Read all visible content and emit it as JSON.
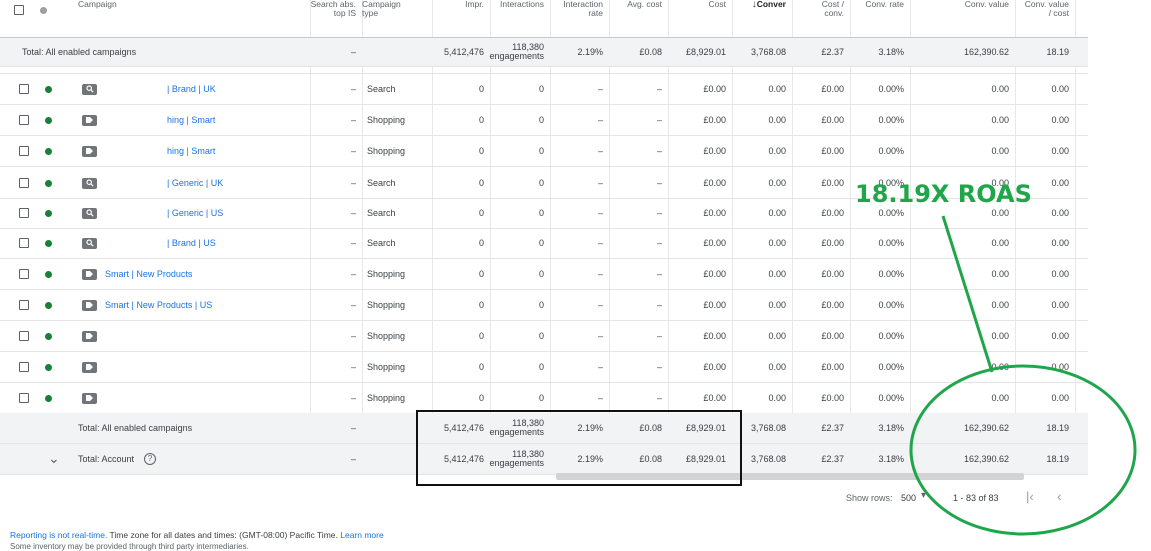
{
  "header": {
    "campaign": "Campaign",
    "search_abs": "Search abs.\ntop IS",
    "campaign_type": "Campaign\ntype",
    "impr": "Impr.",
    "interactions": "Interactions",
    "interaction_rate": "Interaction\nrate",
    "avg_cost": "Avg. cost",
    "cost": "Cost",
    "conversions": "Conver",
    "cost_conv": "Cost /\nconv.",
    "conv_rate": "Conv. rate",
    "conv_value": "Conv. value",
    "conv_value_cost": "Conv. value\n/ cost"
  },
  "top_total": {
    "label": "Total: All enabled campaigns",
    "search_abs": "–",
    "impr": "5,412,476",
    "interactions_1": "118,380",
    "interactions_2": "engagements",
    "interaction_rate": "2.19%",
    "avg_cost": "£0.08",
    "cost": "£8,929.01",
    "conversions": "3,768.08",
    "cost_conv": "£2.37",
    "conv_rate": "3.18%",
    "conv_value": "162,390.62",
    "conv_value_cost": "18.19"
  },
  "rows": [
    {
      "name": "| Brand | UK",
      "icon": "search",
      "search_abs": "–",
      "type": "Search",
      "impr": "0",
      "interactions": "0",
      "interaction_rate": "–",
      "avg_cost": "–",
      "cost": "£0.00",
      "conversions": "0.00",
      "cost_conv": "£0.00",
      "conv_rate": "0.00%",
      "conv_value": "0.00",
      "conv_value_cost": "0.00"
    },
    {
      "name": "hing | Smart",
      "icon": "tag",
      "search_abs": "–",
      "type": "Shopping",
      "impr": "0",
      "interactions": "0",
      "interaction_rate": "–",
      "avg_cost": "–",
      "cost": "£0.00",
      "conversions": "0.00",
      "cost_conv": "£0.00",
      "conv_rate": "0.00%",
      "conv_value": "0.00",
      "conv_value_cost": "0.00"
    },
    {
      "name": "hing | Smart",
      "icon": "tag",
      "search_abs": "–",
      "type": "Shopping",
      "impr": "0",
      "interactions": "0",
      "interaction_rate": "–",
      "avg_cost": "–",
      "cost": "£0.00",
      "conversions": "0.00",
      "cost_conv": "£0.00",
      "conv_rate": "0.00%",
      "conv_value": "0.00",
      "conv_value_cost": "0.00"
    },
    {
      "name": "| Generic | UK",
      "icon": "search",
      "search_abs": "–",
      "type": "Search",
      "impr": "0",
      "interactions": "0",
      "interaction_rate": "–",
      "avg_cost": "–",
      "cost": "£0.00",
      "conversions": "0.00",
      "cost_conv": "£0.00",
      "conv_rate": "0.00%",
      "conv_value": "0.00",
      "conv_value_cost": "0.00"
    },
    {
      "name": "| Generic | US",
      "icon": "search",
      "search_abs": "–",
      "type": "Search",
      "impr": "0",
      "interactions": "0",
      "interaction_rate": "–",
      "avg_cost": "–",
      "cost": "£0.00",
      "conversions": "0.00",
      "cost_conv": "£0.00",
      "conv_rate": "0.00%",
      "conv_value": "0.00",
      "conv_value_cost": "0.00"
    },
    {
      "name": "| Brand | US",
      "icon": "search",
      "search_abs": "–",
      "type": "Search",
      "impr": "0",
      "interactions": "0",
      "interaction_rate": "–",
      "avg_cost": "–",
      "cost": "£0.00",
      "conversions": "0.00",
      "cost_conv": "£0.00",
      "conv_rate": "0.00%",
      "conv_value": "0.00",
      "conv_value_cost": "0.00"
    },
    {
      "name": "Smart | New Products",
      "icon": "tag",
      "search_abs": "–",
      "type": "Shopping",
      "impr": "0",
      "interactions": "0",
      "interaction_rate": "–",
      "avg_cost": "–",
      "cost": "£0.00",
      "conversions": "0.00",
      "cost_conv": "£0.00",
      "conv_rate": "0.00%",
      "conv_value": "0.00",
      "conv_value_cost": "0.00"
    },
    {
      "name": "Smart | New Products | US",
      "icon": "tag",
      "search_abs": "–",
      "type": "Shopping",
      "impr": "0",
      "interactions": "0",
      "interaction_rate": "–",
      "avg_cost": "–",
      "cost": "£0.00",
      "conversions": "0.00",
      "cost_conv": "£0.00",
      "conv_rate": "0.00%",
      "conv_value": "0.00",
      "conv_value_cost": "0.00"
    },
    {
      "name": "",
      "icon": "tag",
      "search_abs": "–",
      "type": "Shopping",
      "impr": "0",
      "interactions": "0",
      "interaction_rate": "–",
      "avg_cost": "–",
      "cost": "£0.00",
      "conversions": "0.00",
      "cost_conv": "£0.00",
      "conv_rate": "0.00%",
      "conv_value": "0.00",
      "conv_value_cost": "0.00"
    },
    {
      "name": "",
      "icon": "tag",
      "search_abs": "–",
      "type": "Shopping",
      "impr": "0",
      "interactions": "0",
      "interaction_rate": "–",
      "avg_cost": "–",
      "cost": "£0.00",
      "conversions": "0.00",
      "cost_conv": "£0.00",
      "conv_rate": "0.00%",
      "conv_value": "0.00",
      "conv_value_cost": "0.00"
    },
    {
      "name": "",
      "icon": "tag",
      "search_abs": "–",
      "type": "Shopping",
      "impr": "0",
      "interactions": "0",
      "interaction_rate": "–",
      "avg_cost": "–",
      "cost": "£0.00",
      "conversions": "0.00",
      "cost_conv": "£0.00",
      "conv_rate": "0.00%",
      "conv_value": "0.00",
      "conv_value_cost": "0.00"
    }
  ],
  "bottom_totals": [
    {
      "label": "Total: All enabled campaigns",
      "search_abs": "–",
      "impr": "5,412,476",
      "interactions_1": "118,380",
      "interactions_2": "engagements",
      "interaction_rate": "2.19%",
      "avg_cost": "£0.08",
      "cost": "£8,929.01",
      "conversions": "3,768.08",
      "cost_conv": "£2.37",
      "conv_rate": "3.18%",
      "conv_value": "162,390.62",
      "conv_value_cost": "18.19"
    },
    {
      "label": "Total: Account",
      "search_abs": "–",
      "impr": "5,412,476",
      "interactions_1": "118,380",
      "interactions_2": "engagements",
      "interaction_rate": "2.19%",
      "avg_cost": "£0.08",
      "cost": "£8,929.01",
      "conversions": "3,768.08",
      "cost_conv": "£2.37",
      "conv_rate": "3.18%",
      "conv_value": "162,390.62",
      "conv_value_cost": "18.19"
    }
  ],
  "footer": {
    "show_rows_label": "Show rows:",
    "show_rows_value": "500",
    "range": "1 - 83 of 83"
  },
  "notes": {
    "line1_link": "Reporting is not real-time.",
    "line1_text": " Time zone for all dates and times: (GMT-08:00) Pacific Time. ",
    "line1_learn": "Learn more",
    "line2": "Some inventory may be provided through third party intermediaries."
  },
  "annotation": {
    "text": "18.19X ROAS",
    "color": "#1fa64a"
  },
  "colors": {
    "link": "#1a73e8",
    "status_enabled": "#188038",
    "total_bg": "#f1f3f4"
  }
}
